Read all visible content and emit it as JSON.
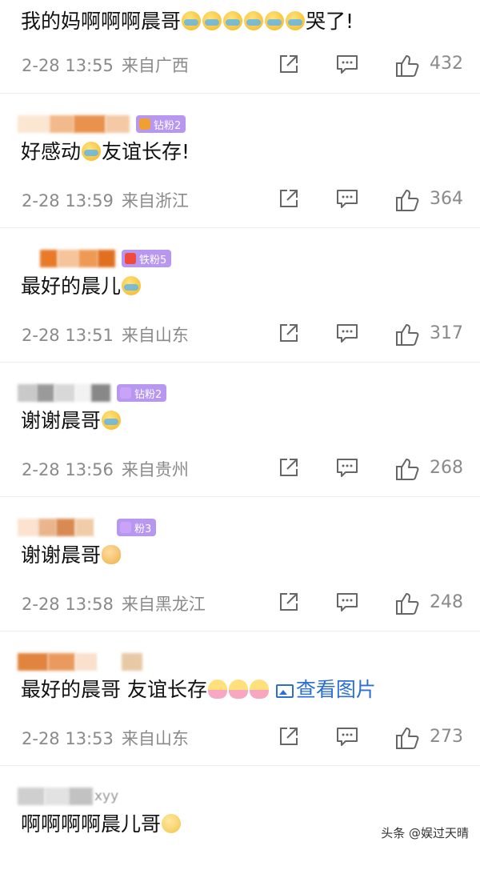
{
  "comments": [
    {
      "user": "",
      "badge": "",
      "text_parts": [
        "我的妈啊啊啊晨哥",
        "哭了!"
      ],
      "date": "2-28 13:55",
      "location": "来自广西",
      "likes": "432"
    },
    {
      "user": "",
      "badge": "钻粉2",
      "text_parts": [
        "好感动",
        "友谊长存!"
      ],
      "date": "2-28 13:59",
      "location": "来自浙江",
      "likes": "364"
    },
    {
      "user": "",
      "badge": "铁粉5",
      "text_parts": [
        "最好的晨儿"
      ],
      "date": "2-28 13:51",
      "location": "来自山东",
      "likes": "317"
    },
    {
      "user": "",
      "badge": "钻粉2",
      "text_parts": [
        "谢谢晨哥"
      ],
      "date": "2-28 13:56",
      "location": "来自贵州",
      "likes": "268"
    },
    {
      "user": "",
      "badge": "粉3",
      "text_parts": [
        "谢谢晨哥"
      ],
      "date": "2-28 13:58",
      "location": "来自黑龙江",
      "likes": "248"
    },
    {
      "user": "",
      "badge": "",
      "text_parts": [
        "最好的晨哥 友谊长存",
        "查看图片"
      ],
      "date": "2-28 13:53",
      "location": "来自山东",
      "likes": "273"
    },
    {
      "user": "xyy",
      "badge": "",
      "text_parts": [
        "啊啊啊啊晨儿哥"
      ]
    }
  ],
  "watermark": "头条 @娱过天晴",
  "icons": {
    "share": "share-icon",
    "comment": "comment-icon",
    "like": "thumbs-up-icon"
  },
  "colors": {
    "link": "#2b6fd6",
    "meta": "#8a8a8a",
    "badge": "#b897f0"
  }
}
